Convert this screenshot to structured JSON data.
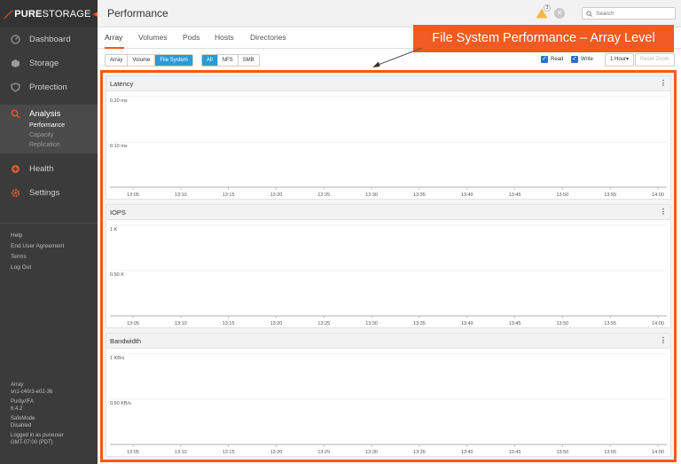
{
  "app": {
    "brand_bold": "PURE",
    "brand_light": "STORAGE",
    "page_title": "Performance"
  },
  "sidebar": {
    "items": [
      {
        "label": "Dashboard",
        "icon": "dashboard-icon"
      },
      {
        "label": "Storage",
        "icon": "storage-icon"
      },
      {
        "label": "Protection",
        "icon": "shield-icon"
      },
      {
        "label": "Analysis",
        "icon": "analysis-icon"
      },
      {
        "label": "Health",
        "icon": "health-icon"
      },
      {
        "label": "Settings",
        "icon": "gear-icon"
      }
    ],
    "analysis_sub": [
      "Performance",
      "Capacity",
      "Replication"
    ],
    "links": [
      "Help",
      "End User Agreement",
      "Terms",
      "Log Out"
    ],
    "info": {
      "array_label": "Array",
      "array_name": "sn1-c40r3-e02-36",
      "os_label": "Purity//FA",
      "os_version": "6.4.2",
      "safemode_label": "SafeMode",
      "safemode_value": "Disabled",
      "login_label": "Logged in as pureuser",
      "timezone": "GMT-07:00 (PDT)"
    }
  },
  "header": {
    "alert_count": "3",
    "search_placeholder": "Search"
  },
  "tabs": [
    "Array",
    "Volumes",
    "Pods",
    "Hosts",
    "Directories"
  ],
  "toolbar": {
    "scope": [
      "Array",
      "Volume",
      "File System"
    ],
    "protocol": [
      "All",
      "NFS",
      "SMB"
    ],
    "read_label": "Read",
    "write_label": "Write",
    "range": "1 Hour",
    "reset_zoom": "Reset Zoom"
  },
  "annotation": "File System Performance – Array Level",
  "colors": {
    "accent": "#f15a22",
    "selected": "#2a9bd8"
  },
  "chart_data": [
    {
      "type": "line",
      "title": "Latency",
      "y_ticks": [
        "0.20 ms",
        "0.10 ms"
      ],
      "x_ticks": [
        "13:05",
        "13:10",
        "13:15",
        "13:20",
        "13:25",
        "13:30",
        "13:35",
        "13:40",
        "13:45",
        "13:50",
        "13:55",
        "14:00"
      ],
      "series": []
    },
    {
      "type": "line",
      "title": "IOPS",
      "y_ticks": [
        "1 K",
        "0.50 K"
      ],
      "x_ticks": [
        "13:05",
        "13:10",
        "13:15",
        "13:20",
        "13:25",
        "13:30",
        "13:35",
        "13:40",
        "13:45",
        "13:50",
        "13:55",
        "14:00"
      ],
      "series": []
    },
    {
      "type": "line",
      "title": "Bandwidth",
      "y_ticks": [
        "1 KB/s",
        "0.50 KB/s"
      ],
      "x_ticks": [
        "13:05",
        "13:10",
        "13:15",
        "13:20",
        "13:25",
        "13:30",
        "13:35",
        "13:40",
        "13:45",
        "13:50",
        "13:55",
        "14:00"
      ],
      "series": []
    }
  ]
}
